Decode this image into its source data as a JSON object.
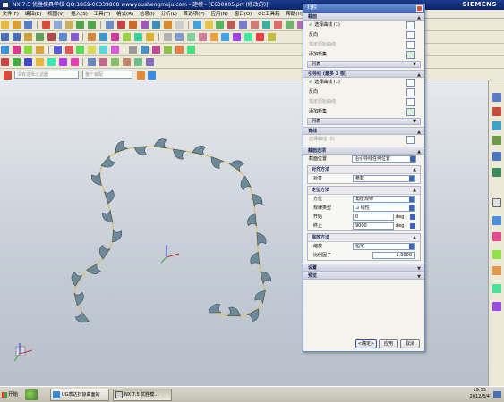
{
  "window": {
    "title": "NX 7.5 优胜模具学校 QQ:1869-00339868 wwwyoushengmuju.com - 建模 - [E600005.prt (修改的)]",
    "brand": "SIEMENS"
  },
  "menubar": {
    "items": [
      "文件(F)",
      "编辑(E)",
      "视图(V)",
      "插入(S)",
      "工具(T)",
      "格式(R)",
      "信息(I)",
      "分析(L)",
      "首选项(P)",
      "应用(N)",
      "窗口(O)",
      "GC工具箱",
      "帮助(H)"
    ]
  },
  "selection_bar": {
    "filter_placeholder": "没有选择过滤器",
    "scope_placeholder": "整个装配"
  },
  "dialog": {
    "title": "扫掠",
    "section1": {
      "header": "截面",
      "select_curve": "选择曲线 (1)",
      "reverse": "反向",
      "specify_origin": "指定原始曲线",
      "add_new_set": "添加新集",
      "list_label": "列表"
    },
    "section2": {
      "header": "引导线 (最多 3 根)",
      "select_curve": "选择曲线 (1)",
      "reverse": "反向",
      "specify_origin": "指定原始曲线",
      "add_new_set": "添加新集",
      "list_label": "列表"
    },
    "spine": {
      "header": "脊线",
      "select_curve": "选择曲线 (0)"
    },
    "section_options": {
      "header": "截面选项",
      "position_label": "截面位置",
      "position_value": "沿引导线任何位置",
      "alignment": {
        "header": "对齐方法",
        "label": "对齐",
        "value": "参数"
      },
      "orientation": {
        "header": "定位方法",
        "direction_label": "方位",
        "direction_value": "角度规律",
        "law_type_label": "规律类型",
        "law_type_value": "线性",
        "start_label": "开始",
        "start_value": "0",
        "start_unit": "deg",
        "end_label": "终止",
        "end_value": "9000",
        "end_unit": "deg"
      },
      "scaling": {
        "header": "缩放方法",
        "scale_label": "缩放",
        "scale_value": "恒定",
        "factor_label": "比例因子",
        "factor_value": "1.0000"
      }
    },
    "settings_header": "设置",
    "preview_header": "预览",
    "buttons": {
      "ok": "<确定>",
      "apply": "应用",
      "cancel": "取消"
    }
  },
  "taskbar": {
    "start_label": "开始",
    "tasks": [
      {
        "label": "UG表达扫掠曲面的"
      },
      {
        "label": "NX 7.5 优胜模..."
      }
    ],
    "clock_time": "19:55",
    "clock_date": "2012/3/4"
  },
  "colors": {
    "sweep_body": "#6d8a9a",
    "guide_curve": "#d6c37a",
    "dialog_title": "#3f66b6",
    "accent_check": "#2e9b2e"
  }
}
